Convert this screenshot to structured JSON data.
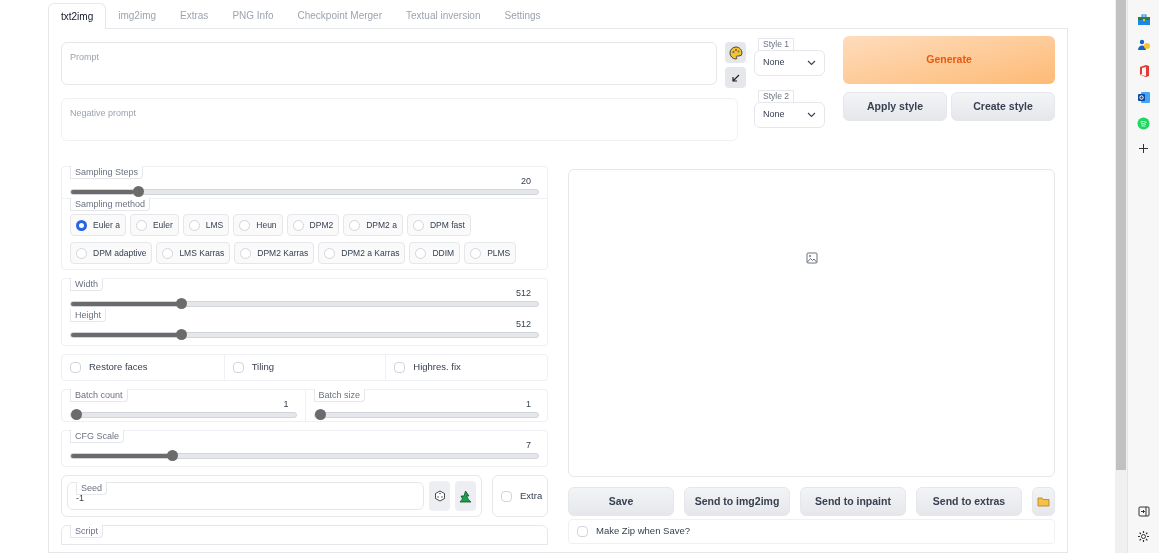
{
  "tabs": [
    {
      "label": "txt2img",
      "selected": true
    },
    {
      "label": "img2img",
      "selected": false
    },
    {
      "label": "Extras",
      "selected": false
    },
    {
      "label": "PNG Info",
      "selected": false
    },
    {
      "label": "Checkpoint Merger",
      "selected": false
    },
    {
      "label": "Textual inversion",
      "selected": false
    },
    {
      "label": "Settings",
      "selected": false
    }
  ],
  "prompt": {
    "placeholder": "Prompt"
  },
  "negative_prompt": {
    "placeholder": "Negative prompt"
  },
  "styles": [
    {
      "label": "Style 1",
      "value": "None"
    },
    {
      "label": "Style 2",
      "value": "None"
    }
  ],
  "generate": "Generate",
  "style_buttons": [
    "Apply style",
    "Create style"
  ],
  "sampling_steps": {
    "label": "Sampling Steps",
    "reading": "20",
    "level": 0.135
  },
  "sampling_method": {
    "label": "Sampling method",
    "options": [
      {
        "label": "Euler a",
        "selected": true
      },
      {
        "label": "Euler",
        "selected": false
      },
      {
        "label": "LMS",
        "selected": false
      },
      {
        "label": "Heun",
        "selected": false
      },
      {
        "label": "DPM2",
        "selected": false
      },
      {
        "label": "DPM2 a",
        "selected": false
      },
      {
        "label": "DPM fast",
        "selected": false
      },
      {
        "label": "DPM adaptive",
        "selected": false
      },
      {
        "label": "LMS Karras",
        "selected": false
      },
      {
        "label": "DPM2 Karras",
        "selected": false
      },
      {
        "label": "DPM2 a Karras",
        "selected": false
      },
      {
        "label": "DDIM",
        "selected": false
      },
      {
        "label": "PLMS",
        "selected": false
      }
    ]
  },
  "size_sliders": [
    {
      "label": "Width",
      "reading": "512",
      "level": 0.23
    },
    {
      "label": "Height",
      "reading": "512",
      "level": 0.23
    }
  ],
  "checkboxes": [
    {
      "label": "Restore faces",
      "checked": false
    },
    {
      "label": "Tiling",
      "checked": false
    },
    {
      "label": "Highres. fix",
      "checked": false
    }
  ],
  "batch_sliders": [
    {
      "label": "Batch count",
      "reading": "1",
      "level": 0
    },
    {
      "label": "Batch size",
      "reading": "1",
      "level": 0
    }
  ],
  "cfg_scale": {
    "label": "CFG Scale",
    "reading": "7",
    "level": 0.21
  },
  "seed": {
    "label": "Seed",
    "value": "-1"
  },
  "extra": {
    "label": "Extra",
    "checked": false
  },
  "script": {
    "label": "Script"
  },
  "output_buttons": [
    "Save",
    "Send to img2img",
    "Send to inpaint",
    "Send to extras"
  ],
  "make_zip": {
    "label": "Make Zip when Save?",
    "checked": false
  }
}
